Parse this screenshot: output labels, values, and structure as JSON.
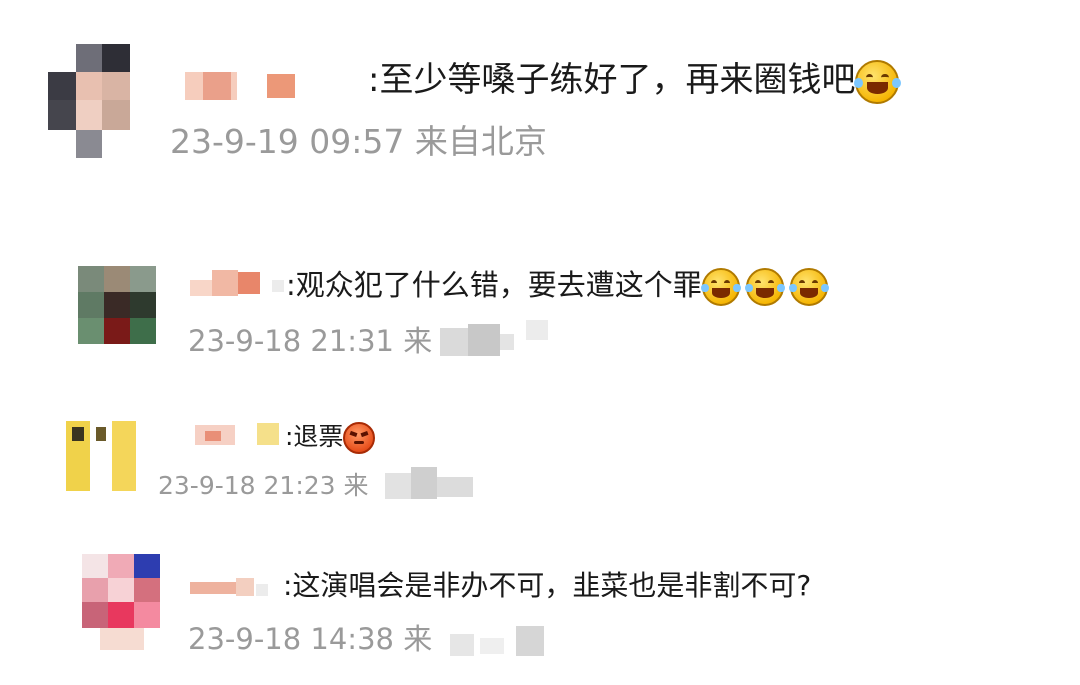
{
  "comments": [
    {
      "text": ":至少等嗓子练好了，再来圈钱吧",
      "emojis": [
        "laugh-crying-emoji"
      ],
      "time": "23-9-19 09:57",
      "location": "来自北京"
    },
    {
      "text": ":观众犯了什么错，要去遭这个罪",
      "emojis": [
        "laugh-crying-emoji",
        "laugh-crying-emoji",
        "laugh-crying-emoji"
      ],
      "time": "23-9-18 21:31",
      "location": "来"
    },
    {
      "text": ":退票",
      "emojis": [
        "angry-face-emoji"
      ],
      "time": "23-9-18 21:23",
      "location": "来"
    },
    {
      "text": ":这演唱会是非办不可，韭菜也是非割不可?",
      "emojis": [],
      "time": "23-9-18 14:38",
      "location": "来"
    }
  ],
  "colors": {
    "text": "#1a1a1a",
    "meta": "#9a9a9a",
    "background": "#ffffff"
  }
}
